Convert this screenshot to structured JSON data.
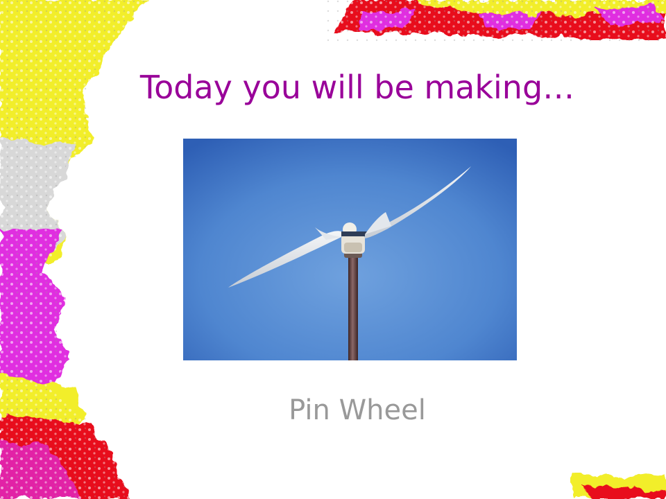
{
  "slide": {
    "title": "Today you will be making…",
    "caption": "Pin Wheel"
  },
  "image": {
    "subject": "wind-turbine-photo"
  },
  "colors": {
    "title": "#990099",
    "caption": "#999999",
    "sky": "#5a8fd4",
    "border_yellow": "#f2ee2a",
    "border_magenta": "#e02ee0",
    "border_red": "#e8101e"
  }
}
